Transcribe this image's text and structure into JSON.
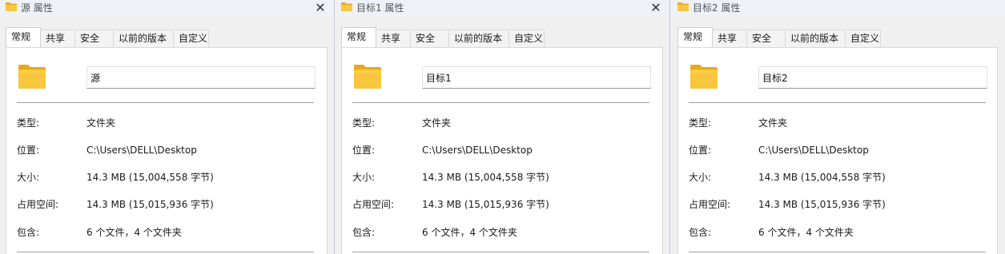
{
  "colors": {
    "folder_body": "#f8c73e",
    "folder_tab": "#e9a91c",
    "folder_front": "#ffd75c"
  },
  "icons": {
    "title_icon": "folder-icon",
    "close_icon": "close-icon",
    "big_icon": "folder-icon"
  },
  "close_glyph": "✕",
  "tabs": [
    "常规",
    "共享",
    "安全",
    "以前的版本",
    "自定义"
  ],
  "labels": {
    "type": "类型:",
    "location": "位置:",
    "size": "大小:",
    "size_on_disk": "占用空间:",
    "contains": "包含:"
  },
  "windows": [
    {
      "title": "源 属性",
      "name": "源",
      "type": "文件夹",
      "location": "C:\\Users\\DELL\\Desktop",
      "size": "14.3 MB (15,004,558 字节)",
      "size_on_disk": "14.3 MB (15,015,936 字节)",
      "contains": "6 个文件，4 个文件夹"
    },
    {
      "title": "目标1 属性",
      "name": "目标1",
      "type": "文件夹",
      "location": "C:\\Users\\DELL\\Desktop",
      "size": "14.3 MB (15,004,558 字节)",
      "size_on_disk": "14.3 MB (15,015,936 字节)",
      "contains": "6 个文件，4 个文件夹"
    },
    {
      "title": "目标2 属性",
      "name": "目标2",
      "type": "文件夹",
      "location": "C:\\Users\\DELL\\Desktop",
      "size": "14.3 MB (15,004,558 字节)",
      "size_on_disk": "14.3 MB (15,015,936 字节)",
      "contains": "6 个文件，4 个文件夹"
    }
  ]
}
